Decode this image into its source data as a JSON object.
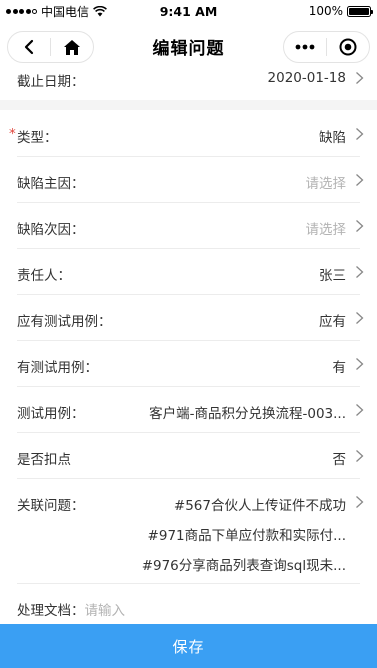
{
  "status_bar": {
    "carrier": "中国电信",
    "time": "9:41 AM",
    "battery": "100%"
  },
  "nav": {
    "title": "编辑问题"
  },
  "rows": {
    "deadline": {
      "label": "截止日期：",
      "value": "2020-01-18"
    },
    "type": {
      "label": "类型：",
      "value": "缺陷",
      "required_mark": "*"
    },
    "main_cause": {
      "label": "缺陷主因：",
      "value": "请选择"
    },
    "secondary_cause": {
      "label": "缺陷次因：",
      "value": "请选择"
    },
    "owner": {
      "label": "责任人：",
      "value": "张三"
    },
    "should_have_case": {
      "label": "应有测试用例：",
      "value": "应有"
    },
    "has_case": {
      "label": "有测试用例：",
      "value": "有"
    },
    "test_case": {
      "label": "测试用例：",
      "value": "客户端-商品积分兑换流程-003..."
    },
    "deduct": {
      "label": "是否扣点",
      "value": "否"
    },
    "related": {
      "label": "关联问题：",
      "items": [
        "#567合伙人上传证件不成功",
        "#971商品下单应付款和实际付...",
        "#976分享商品列表查询sql现未..."
      ]
    },
    "document": {
      "label": "处理文档：",
      "placeholder": "请输入"
    }
  },
  "save_button": {
    "label": "保存"
  },
  "colors": {
    "accent": "#3a9ff3",
    "required": "#e0463c",
    "placeholder": "#b3b3b3"
  },
  "icons": [
    "back-icon",
    "home-icon",
    "more-icon",
    "close-icon",
    "wifi-icon",
    "chevron-right-icon"
  ]
}
